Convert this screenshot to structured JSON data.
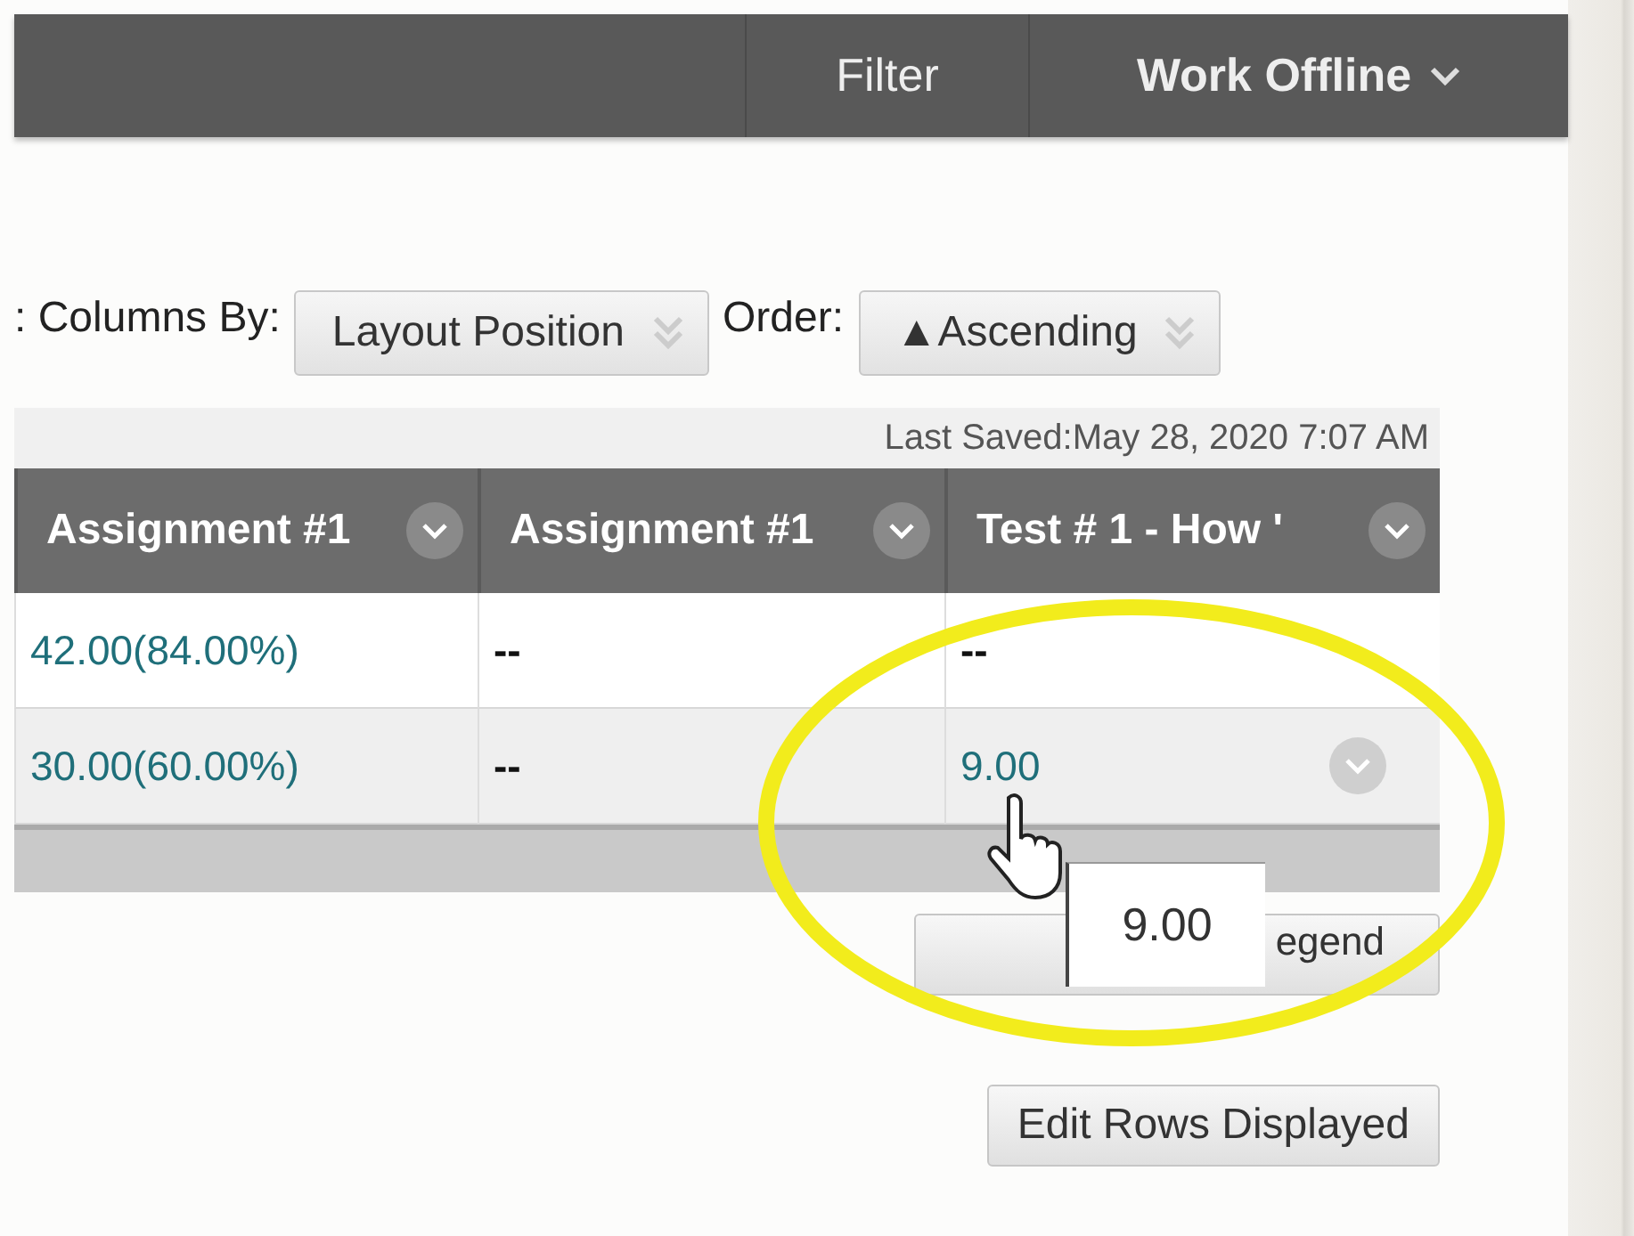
{
  "top_bar": {
    "items": [
      {
        "label": "Filter",
        "kind": "plain"
      },
      {
        "label": "Work Offline",
        "kind": "menu"
      }
    ]
  },
  "sort": {
    "columns_label": ": Columns By:",
    "columns_value": "Layout Position",
    "order_label": "Order:",
    "order_value": "▲Ascending"
  },
  "last_saved": "Last Saved:May 28, 2020 7:07 AM",
  "table": {
    "columns": [
      {
        "label": "Assignment #1"
      },
      {
        "label": "Assignment #1"
      },
      {
        "label": "Test # 1 - How '"
      }
    ],
    "rows": [
      {
        "cells": [
          {
            "text": "42.00(84.00%)",
            "kind": "link"
          },
          {
            "text": "--",
            "kind": "plain"
          },
          {
            "text": "--",
            "kind": "plain"
          }
        ],
        "selected": false
      },
      {
        "cells": [
          {
            "text": "30.00(60.00%)",
            "kind": "link"
          },
          {
            "text": "--",
            "kind": "plain"
          },
          {
            "text": "9.00",
            "kind": "link",
            "menu": true
          }
        ],
        "selected": true
      }
    ]
  },
  "tooltip": "9.00",
  "legend_button": "egend",
  "edit_rows_button": "Edit Rows Displayed"
}
